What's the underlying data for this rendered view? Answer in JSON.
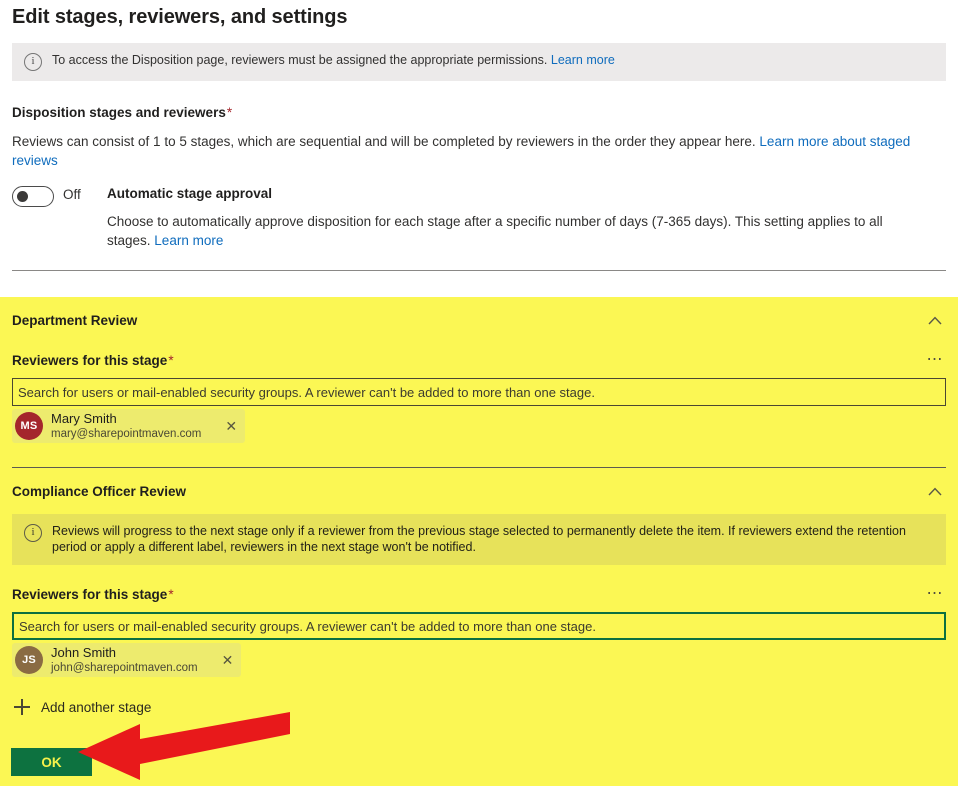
{
  "page": {
    "title": "Edit stages, reviewers, and settings"
  },
  "top_info": {
    "icon": "info-icon",
    "text": "To access the Disposition page, reviewers must be assigned the appropriate permissions.",
    "link_label": "Learn more"
  },
  "disposition": {
    "label": "Disposition stages and reviewers",
    "required_marker": "*",
    "description": "Reviews can consist of 1 to 5 stages, which are sequential and will be completed by reviewers in the order they appear here.",
    "link_label": "Learn more about staged reviews"
  },
  "auto_approval": {
    "toggle_state": "Off",
    "toggle_on": false,
    "title": "Automatic stage approval",
    "description": "Choose to automatically approve disposition for each stage after a specific number of days (7-365 days). This setting applies to all stages.",
    "link_label": "Learn more"
  },
  "stages": [
    {
      "title": "Department Review",
      "collapse_icon": "chevron-up-icon",
      "overflow_icon": "ellipsis-icon",
      "reviewers_label": "Reviewers for this stage",
      "required_marker": "*",
      "search_placeholder": "Search for users or mail-enabled security groups. A reviewer can't be added to more than one stage.",
      "search_focused": false,
      "info_note": null,
      "reviewers": [
        {
          "initials": "MS",
          "avatar_color": "#a4262c",
          "name": "Mary Smith",
          "email": "mary@sharepointmaven.com",
          "remove_icon": "close-icon"
        }
      ]
    },
    {
      "title": "Compliance Officer Review",
      "collapse_icon": "chevron-up-icon",
      "overflow_icon": "ellipsis-icon",
      "reviewers_label": "Reviewers for this stage",
      "required_marker": "*",
      "search_placeholder": "Search for users or mail-enabled security groups. A reviewer can't be added to more than one stage.",
      "search_focused": true,
      "info_note": "Reviews will progress to the next stage only if a reviewer from the previous stage selected to permanently delete the item. If reviewers extend the retention period or apply a different label, reviewers in the next stage won't be notified.",
      "reviewers": [
        {
          "initials": "JS",
          "avatar_color": "#8a6b43",
          "name": "John Smith",
          "email": "john@sharepointmaven.com",
          "remove_icon": "close-icon"
        }
      ]
    }
  ],
  "add_stage": {
    "icon": "plus-icon",
    "label": "Add another stage"
  },
  "primary_button": {
    "label": "OK"
  },
  "annotation": {
    "arrow_color": "#e8191b",
    "points_to": "OK"
  },
  "colors": {
    "highlight_yellow": "#fbf754",
    "info_gray": "#eceaea",
    "info_yellow": "#e7e25a",
    "link_blue": "#0f6cbd",
    "required_red": "#a4262c",
    "ok_green": "#0d7240",
    "ok_text": "#f7f14a",
    "focus_green": "#0b7040"
  }
}
